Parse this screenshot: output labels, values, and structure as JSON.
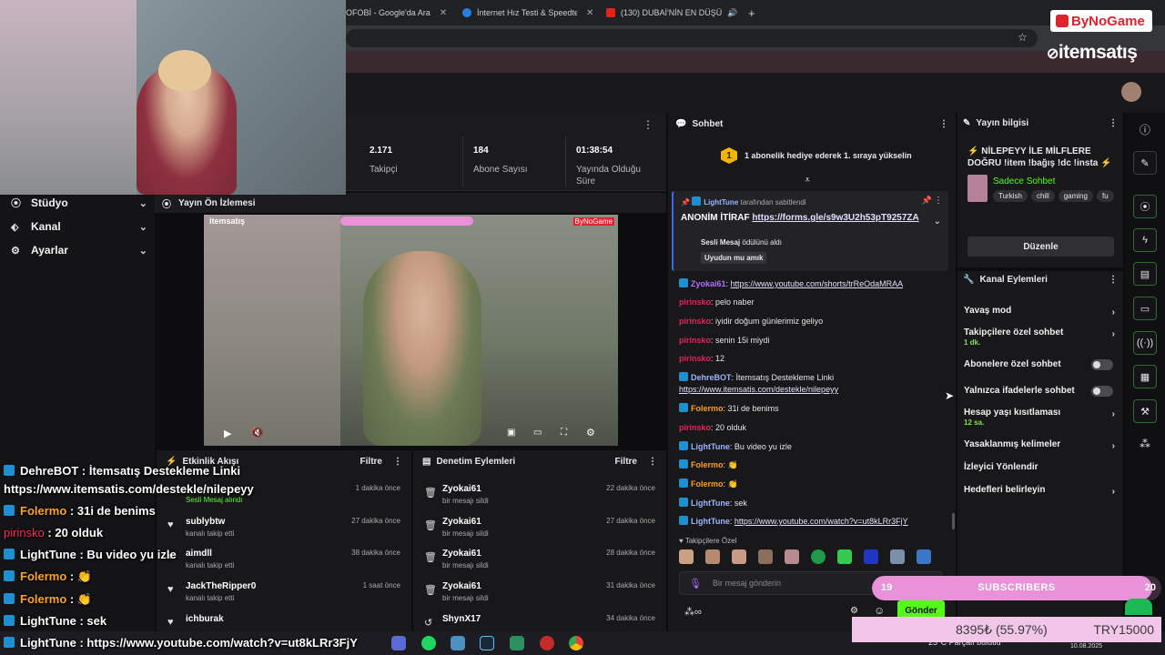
{
  "browser": {
    "tabs": [
      {
        "title": "OFOBİ - Google'da Ara",
        "color": "#4285f4"
      },
      {
        "title": "İnternet Hız Testi & Speedtest",
        "color": "#2a7de1"
      },
      {
        "title": "(130) DUBAİ'NİN EN DÜŞÜ",
        "color": "#e62117"
      }
    ],
    "new_tab": "+"
  },
  "brand": {
    "bynogame": "ByNoGame",
    "itemsatis": "itemsatış"
  },
  "sidebar": {
    "items": [
      {
        "label": "Stüdyo",
        "icon": "studio-icon"
      },
      {
        "label": "Kanal",
        "icon": "channel-icon"
      },
      {
        "label": "Ayarlar",
        "icon": "gear-icon"
      }
    ]
  },
  "stats": [
    {
      "value": "2.171",
      "label": "Takipçi"
    },
    {
      "value": "184",
      "label": "Abone Sayısı"
    },
    {
      "value": "01:38:54",
      "label": "Yayında Olduğu Süre"
    }
  ],
  "preview": {
    "title": "Yayın Ön İzlemesi",
    "overlay_left": "itemsatış",
    "overlay_right": "ByNoGame"
  },
  "activity": {
    "title": "Etkinlik Akışı",
    "filter": "Filtre",
    "rows": [
      {
        "name": "",
        "sub": "Sesli Mesaj alındı",
        "time": "1 dakika önce"
      },
      {
        "name": "sublybtw",
        "sub": "kanalı takip etti",
        "time": "27 dakika önce"
      },
      {
        "name": "aimdll",
        "sub": "kanalı takip etti",
        "time": "38 dakika önce"
      },
      {
        "name": "JackTheRipper0",
        "sub": "kanalı takip etti",
        "time": "1 saat önce"
      },
      {
        "name": "ichburak",
        "sub": "",
        "time": ""
      }
    ]
  },
  "moderation": {
    "title": "Denetim Eylemleri",
    "filter": "Filtre",
    "rows": [
      {
        "name": "Zyokai61",
        "sub": "bir mesajı sildi",
        "time": "22 dakika önce"
      },
      {
        "name": "Zyokai61",
        "sub": "bir mesajı sildi",
        "time": "27 dakika önce"
      },
      {
        "name": "Zyokai61",
        "sub": "bir mesajı sildi",
        "time": "28 dakika önce"
      },
      {
        "name": "Zyokai61",
        "sub": "bir mesajı sildi",
        "time": "31 dakika önce"
      },
      {
        "name": "ShynX17",
        "sub": "",
        "time": "34 dakika önce"
      }
    ]
  },
  "chat": {
    "title": "Sohbet",
    "gift_banner": "1 abonelik hediye ederek 1. sıraya yükselin",
    "gift_rank": "1",
    "pinned_by": "LightTune",
    "pinned_suffix": "tarafından sabitlendi",
    "pinned_text": "ANONİM İTİRAF",
    "pinned_link": "https://forms.gle/s9w3U2h53pT9257ZA",
    "voice_label": "Sesli Mesaj",
    "voice_suffix": "ödülünü aldı",
    "voice_text": "Uyudun mu amık",
    "messages": [
      {
        "user": "Zyokai61",
        "color": "#b070ff",
        "text": "https://www.youtube.com/shorts/trReOdaMRAA",
        "link": true
      },
      {
        "user": "pirinsko",
        "color": "#e2245c",
        "text": "pelo naber"
      },
      {
        "user": "pirinsko",
        "color": "#e2245c",
        "text": "iyidir doğum günlerimiz geliyo"
      },
      {
        "user": "pirinsko",
        "color": "#e2245c",
        "text": "senin 15i miydi"
      },
      {
        "user": "pirinsko",
        "color": "#e2245c",
        "text": "12"
      },
      {
        "user": "DehreBOT",
        "color": "#9ab4ff",
        "text": "İtemsatış Destekleme Linki",
        "link2": "https://www.itemsatis.com/destekle/nilepeyy"
      },
      {
        "user": "Folermo",
        "color": "#ff9e1a",
        "text": "31i de benims"
      },
      {
        "user": "pirinsko",
        "color": "#e2245c",
        "text": "20 olduk"
      },
      {
        "user": "LightTune",
        "color": "#9ab4ff",
        "text": "Bu video yu izle"
      },
      {
        "user": "Folermo",
        "color": "#ff9e1a",
        "text": "👏"
      },
      {
        "user": "Folermo",
        "color": "#ff9e1a",
        "text": "👏"
      },
      {
        "user": "LightTune",
        "color": "#9ab4ff",
        "text": "sek"
      },
      {
        "user": "LightTune",
        "color": "#9ab4ff",
        "text": "https://www.youtube.com/watch?v=ut8kLRr3FjY",
        "link": true
      }
    ],
    "followers_only_label": "Takipçilere Özel",
    "input_placeholder": "Bir mesaj gönderin",
    "send": "Gönder"
  },
  "stream_info": {
    "title": "Yayın bilgisi",
    "stream_title": "⚡ NİLEPEYY İLE MİLFLERE DOĞRU !item !bağış !dc !insta ⚡",
    "category": "Sadece Sohbet",
    "tags": [
      "Turkish",
      "chill",
      "gaming",
      "fu"
    ],
    "edit": "Düzenle"
  },
  "channel_actions": {
    "title": "Kanal Eylemleri",
    "items": [
      {
        "label": "Yavaş mod",
        "sub": "",
        "control": "chevron"
      },
      {
        "label": "Takipçilere özel sohbet",
        "sub": "1 dk.",
        "control": "chevron"
      },
      {
        "label": "Abonelere özel sohbet",
        "sub": "",
        "control": "toggle"
      },
      {
        "label": "Yalnızca ifadelerle sohbet",
        "sub": "",
        "control": "toggle"
      },
      {
        "label": "Hesap yaşı kısıtlaması",
        "sub": "12 sa.",
        "control": "chevron"
      },
      {
        "label": "Yasaklanmış kelimeler",
        "sub": "",
        "control": "chevron"
      },
      {
        "label": "İzleyici Yönlendir",
        "sub": "",
        "control": "none"
      },
      {
        "label": "Hedefleri belirleyin",
        "sub": "",
        "control": "chevron"
      }
    ]
  },
  "overlay_chat": [
    {
      "user": "DehreBOT",
      "color": "#ffffff",
      "text": ": İtemsatış Destekleme Linki"
    },
    {
      "user": "",
      "color": "#ffffff",
      "text": "https://www.itemsatis.com/destekle/nilepeyy"
    },
    {
      "user": "Folermo",
      "color": "#ffa31a",
      "text": ": 31i de benims"
    },
    {
      "user": "pirinsko",
      "color": "#ff2a5c",
      "text": ": 20 olduk"
    },
    {
      "user": "LightTune",
      "color": "#ffffff",
      "text": ": Bu video yu izle"
    },
    {
      "user": "Folermo",
      "color": "#ffa31a",
      "text": ": 👏"
    },
    {
      "user": "Folermo",
      "color": "#ffa31a",
      "text": ": 👏"
    },
    {
      "user": "LightTune",
      "color": "#ffffff",
      "text": ": sek"
    },
    {
      "user": "LightTune",
      "color": "#ffffff",
      "text": ": https://www.youtube.com/watch?v=ut8kLRr3FjY"
    }
  ],
  "sub_goal": {
    "start": "19",
    "label": "SUBSCRIBERS",
    "end": "20",
    "progress": 0.97
  },
  "donation": {
    "current": "8395₺ (55.97%)",
    "target": "TRY15000"
  },
  "taskbar": {
    "weather": "25°C Parçalı bulutlu",
    "date": "10.08.2025"
  },
  "colors": {
    "accent": "#53fc18",
    "panel": "#18181b",
    "sub_bar": "#e991d9"
  }
}
